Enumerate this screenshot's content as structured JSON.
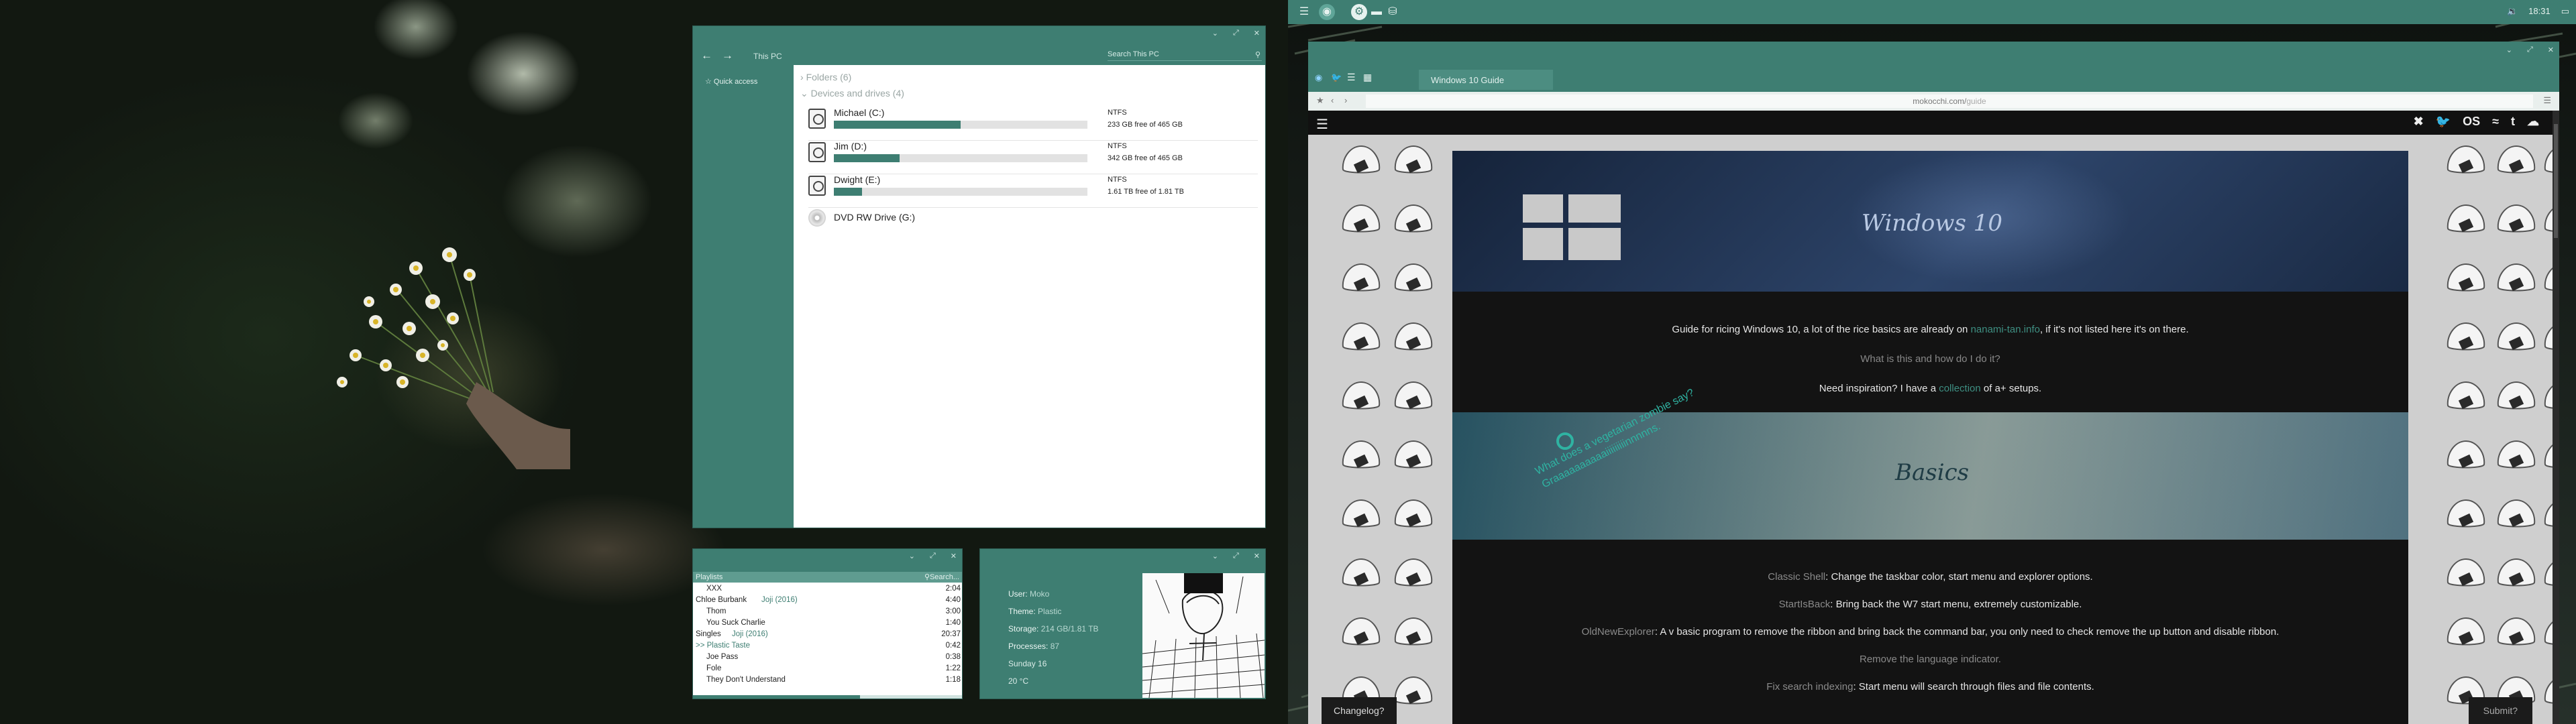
{
  "explorer": {
    "path": "This PC",
    "search_placeholder": "Search This PC",
    "quick_access": "Quick access",
    "folders_group": "Folders (6)",
    "devices_group": "Devices and drives (4)",
    "drives": [
      {
        "name": "Michael (C:)",
        "fs": "NTFS",
        "free": "233 GB free of 465 GB",
        "used_fraction": 0.5
      },
      {
        "name": "Jim (D:)",
        "fs": "NTFS",
        "free": "342 GB free of 465 GB",
        "used_fraction": 0.26
      },
      {
        "name": "Dwight (E:)",
        "fs": "NTFS",
        "free": "1.61 TB free of 1.81 TB",
        "used_fraction": 0.11
      }
    ],
    "dvd": "DVD RW Drive (G:)"
  },
  "music": {
    "playlists_label": "Playlists",
    "search_label": "Search...",
    "progress_fraction": 0.62,
    "rows": [
      {
        "a": "XXX",
        "b": "",
        "t": "2:04",
        "indent": 2
      },
      {
        "a": "Chloe Burbank",
        "b": "Joji (2016)",
        "t": "4:40",
        "indent": 0
      },
      {
        "a": "Thom",
        "b": "",
        "t": "3:00",
        "indent": 2
      },
      {
        "a": "You Suck Charlie",
        "b": "",
        "t": "1:40",
        "indent": 2
      },
      {
        "a": "Singles",
        "b": "Joji (2016)",
        "t": "20:37",
        "indent": 0
      },
      {
        "a": ">> Plastic Taste",
        "b": "",
        "t": "0:42",
        "indent": 0,
        "active": true
      },
      {
        "a": "Joe Pass",
        "b": "",
        "t": "0:38",
        "indent": 2
      },
      {
        "a": "Fole",
        "b": "",
        "t": "1:22",
        "indent": 2
      },
      {
        "a": "They Don't Understand",
        "b": "",
        "t": "1:18",
        "indent": 2
      }
    ]
  },
  "sysinfo": {
    "user_k": "User:",
    "user_v": "Moko",
    "theme_k": "Theme:",
    "theme_v": "Plastic",
    "storage_k": "Storage:",
    "storage_v": "214 GB/1.81 TB",
    "processes_k": "Processes:",
    "processes_v": "87",
    "date": "Sunday 16",
    "temp": "20 °C"
  },
  "taskbar": {
    "clock": "18:31",
    "volume_icon": "speaker-icon",
    "chat_icon": "chat-icon"
  },
  "browser": {
    "tab_title": "Windows 10 Guide",
    "url_host": "mokocchi.com/",
    "url_path": "guide",
    "social": [
      "✖",
      "🐦",
      "OS",
      "≈",
      "t",
      "☁"
    ],
    "hero_title": "Windows 10",
    "intro_prefix": "Guide for ricing Windows 10, a lot of the rice basics are already on ",
    "intro_link": "nanami-tan.info",
    "intro_suffix": ", if it's not listed here it's on there.",
    "what_is": "What is this and how do I do it?",
    "inspo_prefix": "Need inspiration? I have a ",
    "inspo_link": "collection",
    "inspo_suffix": " of a+ setups.",
    "basics_title": "Basics",
    "graffiti": "What does a vegetarian zombie say? Graaaaaaaaaaiiiiiiiiinnnnns.",
    "tips": [
      {
        "name": "Classic Shell",
        "desc": ": Change the taskbar color, start menu and explorer options."
      },
      {
        "name": "StartIsBack",
        "desc": ": Bring back the W7 start menu, extremely customizable."
      },
      {
        "name": "OldNewExplorer",
        "desc": ": A v basic program to remove the ribbon and bring back the command bar, you only need to check remove the up button and disable ribbon."
      },
      {
        "name": "Remove the language indicator.",
        "desc": ""
      },
      {
        "name": "Fix search indexing",
        "desc": ": Start menu will search through files and file contents."
      }
    ],
    "changelog": "Changelog?",
    "submit": "Submit?"
  }
}
